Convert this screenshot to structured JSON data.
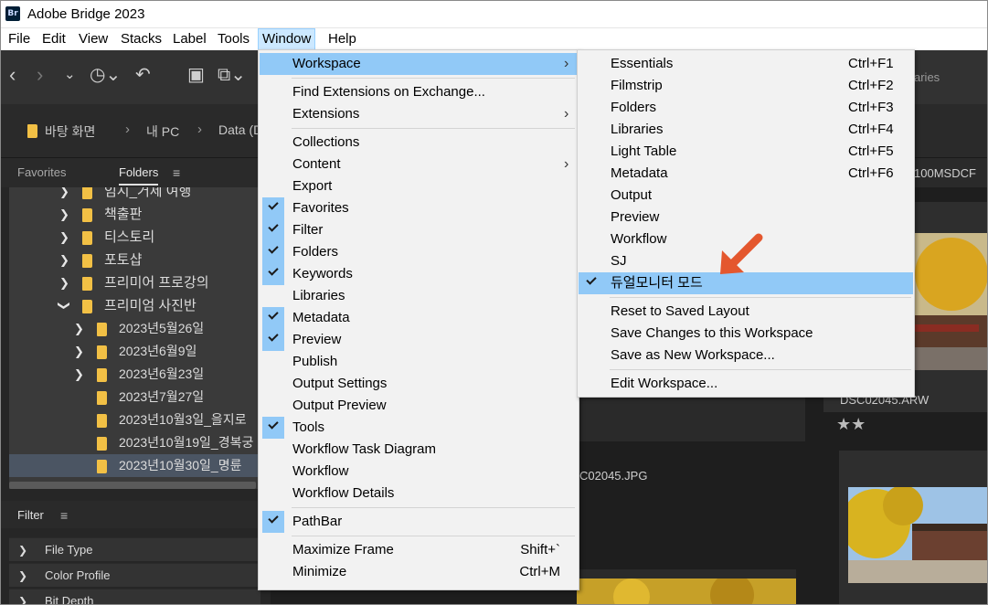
{
  "app": {
    "logo_text": "Br",
    "title": "Adobe Bridge 2023"
  },
  "menubar": [
    "File",
    "Edit",
    "View",
    "Stacks",
    "Label",
    "Tools",
    "Window",
    "Help"
  ],
  "toolbar": {
    "right_label": "aries"
  },
  "pathbar": {
    "crumbs": [
      "바탕 화면",
      "내 PC",
      "Data (D"
    ]
  },
  "left_panel": {
    "tabs": [
      "Favorites",
      "Folders"
    ],
    "tree": [
      {
        "label": "임시_거제 여행",
        "level": 1,
        "expand": "right"
      },
      {
        "label": "책출판",
        "level": 1,
        "expand": "right"
      },
      {
        "label": "티스토리",
        "level": 1,
        "expand": "right"
      },
      {
        "label": "포토샵",
        "level": 1,
        "expand": "right"
      },
      {
        "label": "프리미어 프로강의",
        "level": 1,
        "expand": "right"
      },
      {
        "label": "프리미엄 사진반",
        "level": 1,
        "expand": "down"
      },
      {
        "label": "2023년5월26일",
        "level": 2,
        "expand": "right"
      },
      {
        "label": "2023년6월9일",
        "level": 2,
        "expand": "right"
      },
      {
        "label": "2023년6월23일",
        "level": 2,
        "expand": "right"
      },
      {
        "label": "2023년7월27일",
        "level": 2,
        "expand": ""
      },
      {
        "label": "2023년10월3일_을지로",
        "level": 2,
        "expand": ""
      },
      {
        "label": "2023년10월19일_경복궁",
        "level": 2,
        "expand": ""
      },
      {
        "label": "2023년10월30일_명륜",
        "level": 2,
        "expand": "",
        "selected": true
      }
    ],
    "filter": {
      "title": "Filter",
      "rows": [
        "File Type",
        "Color Profile",
        "Bit Depth"
      ]
    }
  },
  "content": {
    "folder_label": "100MSDCF",
    "thumbs": [
      "DSC02045.ARW",
      "C02045.JPG"
    ]
  },
  "window_menu": {
    "items": [
      {
        "label": "Workspace",
        "submenu": true,
        "highlighted": true
      },
      {
        "sep": true
      },
      {
        "label": "Find Extensions on Exchange..."
      },
      {
        "label": "Extensions",
        "submenu": true
      },
      {
        "sep": true
      },
      {
        "label": "Collections"
      },
      {
        "label": "Content",
        "submenu": true
      },
      {
        "label": "Export"
      },
      {
        "label": "Favorites",
        "checked": true
      },
      {
        "label": "Filter",
        "checked": true
      },
      {
        "label": "Folders",
        "checked": true
      },
      {
        "label": "Keywords",
        "checked": true
      },
      {
        "label": "Libraries"
      },
      {
        "label": "Metadata",
        "checked": true
      },
      {
        "label": "Preview",
        "checked": true
      },
      {
        "label": "Publish"
      },
      {
        "label": "Output Settings"
      },
      {
        "label": "Output Preview"
      },
      {
        "label": "Tools",
        "checked": true
      },
      {
        "label": "Workflow Task Diagram"
      },
      {
        "label": "Workflow"
      },
      {
        "label": "Workflow Details"
      },
      {
        "sep": true
      },
      {
        "label": "PathBar",
        "checked": true
      },
      {
        "sep": true
      },
      {
        "label": "Maximize Frame",
        "shortcut": "Shift+`"
      },
      {
        "label": "Minimize",
        "shortcut": "Ctrl+M"
      }
    ]
  },
  "workspace_menu": {
    "items": [
      {
        "label": "Essentials",
        "shortcut": "Ctrl+F1"
      },
      {
        "label": "Filmstrip",
        "shortcut": "Ctrl+F2"
      },
      {
        "label": "Folders",
        "shortcut": "Ctrl+F3"
      },
      {
        "label": "Libraries",
        "shortcut": "Ctrl+F4"
      },
      {
        "label": "Light Table",
        "shortcut": "Ctrl+F5"
      },
      {
        "label": "Metadata",
        "shortcut": "Ctrl+F6"
      },
      {
        "label": "Output"
      },
      {
        "label": "Preview"
      },
      {
        "label": "Workflow"
      },
      {
        "label": "SJ"
      },
      {
        "label": "듀얼모니터 모드",
        "checked": true,
        "highlighted": true
      },
      {
        "sep": true
      },
      {
        "label": "Reset to Saved Layout"
      },
      {
        "label": "Save Changes to this Workspace"
      },
      {
        "label": "Save as New Workspace..."
      },
      {
        "sep": true
      },
      {
        "label": "Edit Workspace..."
      }
    ]
  },
  "colors": {
    "menu_highlight": "#91c9f7",
    "annotation_arrow": "#e4572e",
    "folder": "#f2c045"
  }
}
